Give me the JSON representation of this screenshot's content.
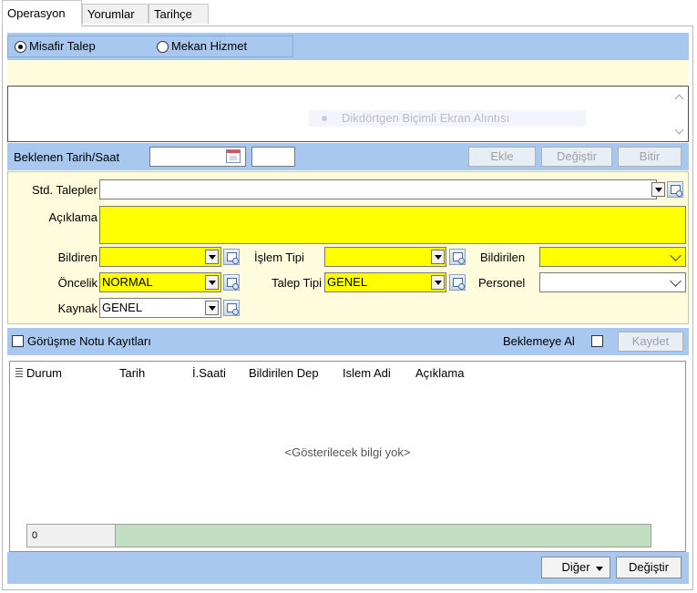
{
  "tabs": [
    {
      "label": "Operasyon"
    },
    {
      "label": "Yorumlar"
    },
    {
      "label": "Tarihçe"
    }
  ],
  "request_type": {
    "option1": "Misafir Talep",
    "option2": "Mekan Hizmet"
  },
  "textarea": {
    "watermark": "Dikdörtgen Biçimli Ekran Alıntısı"
  },
  "expected": {
    "label": "Beklenen Tarih/Saat",
    "add_label": "Ekle",
    "change_label": "Değiştir",
    "finish_label": "Bitir"
  },
  "form": {
    "std_label": "Std. Talepler",
    "description_label": "Açıklama",
    "reporter_label": "Bildiren",
    "operation_type_label": "İşlem Tipi",
    "notified_label": "Bildirilen",
    "priority_label": "Öncelik",
    "priority_value": "NORMAL",
    "request_type_label": "Talep Tipi",
    "request_type_value": "GENEL",
    "personnel_label": "Personel",
    "source_label": "Kaynak",
    "source_value": "GENEL"
  },
  "notes_bar": {
    "meeting_notes_label": "Görüşme Notu Kayıtları",
    "hold_label": "Beklemeye Al",
    "save_label": "Kaydet"
  },
  "grid": {
    "columns": [
      "Durum",
      "Tarih",
      "İ.Saati",
      "Bildirilen Dep",
      "Islem Adi",
      "Açıklama"
    ],
    "empty_text": "<Gösterilecek bilgi yok>",
    "footer_count": "0"
  },
  "bottom": {
    "other_label": "Diğer",
    "change_label": "Değiştir"
  },
  "colors": {
    "panel_blue": "#a8c8f0",
    "cream": "#fffbdc",
    "required_yellow": "#ffff00",
    "grid_footer_green": "#c2dfc2"
  }
}
